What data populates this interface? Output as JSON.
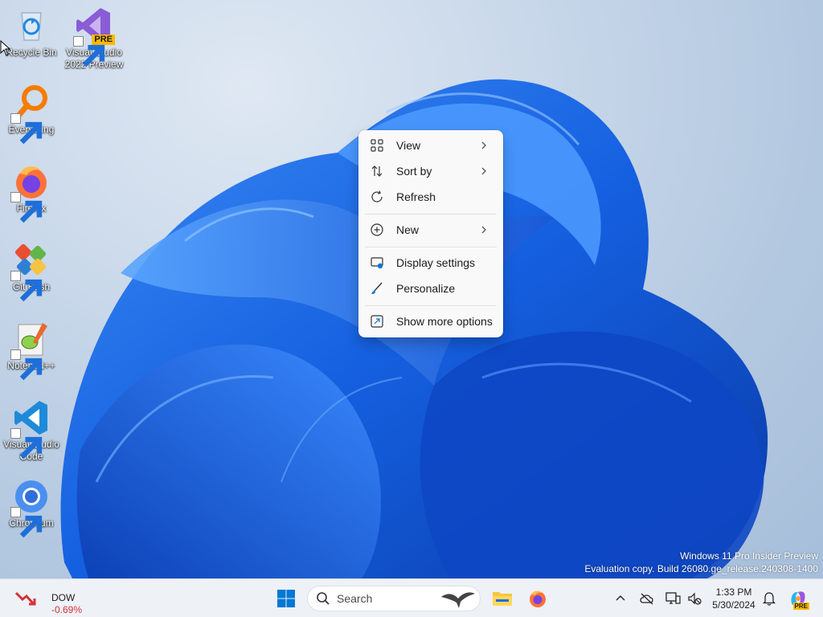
{
  "desktop": {
    "icons": [
      {
        "label_1": "Recycle Bin",
        "label_2": "",
        "icon": "recycle-bin-icon"
      },
      {
        "label_1": "Visual Studio",
        "label_2": "2022 Preview",
        "badge": "PRE",
        "icon": "visual-studio-icon"
      },
      {
        "label_1": "Everything",
        "label_2": "",
        "icon": "everything-search-icon"
      },
      {
        "label_1": "Firefox",
        "label_2": "",
        "icon": "firefox-icon"
      },
      {
        "label_1": "Git Bash",
        "label_2": "",
        "icon": "git-bash-icon"
      },
      {
        "label_1": "Notepad++",
        "label_2": "",
        "icon": "notepad-plus-plus-icon"
      },
      {
        "label_1": "Visual Studio",
        "label_2": "Code",
        "icon": "vscode-icon"
      },
      {
        "label_1": "Chromium",
        "label_2": "",
        "icon": "chromium-icon"
      }
    ],
    "watermark": {
      "line1": "Windows 11 Pro Insider Preview",
      "line2": "Evaluation copy. Build 26080.ge_release.240308-1400"
    }
  },
  "context_menu": {
    "items": [
      {
        "label": "View",
        "icon": "grid-view-icon",
        "submenu": true
      },
      {
        "label": "Sort by",
        "icon": "sort-arrows-icon",
        "submenu": true
      },
      {
        "label": "Refresh",
        "icon": "refresh-icon",
        "submenu": false
      },
      {
        "label": "New",
        "icon": "plus-circle-icon",
        "submenu": true
      },
      {
        "label": "Display settings",
        "icon": "display-icon",
        "submenu": false
      },
      {
        "label": "Personalize",
        "icon": "brush-icon",
        "submenu": false
      },
      {
        "label": "Show more options",
        "icon": "expand-icon",
        "submenu": false
      }
    ]
  },
  "taskbar": {
    "widget": {
      "name": "DOW",
      "change": "-0.69%",
      "change_color": "#d13438"
    },
    "search_placeholder": "Search",
    "clock": {
      "time": "1:33 PM",
      "date": "5/30/2024"
    },
    "copilot_badge": "PRE",
    "accent": "#0078d4"
  }
}
